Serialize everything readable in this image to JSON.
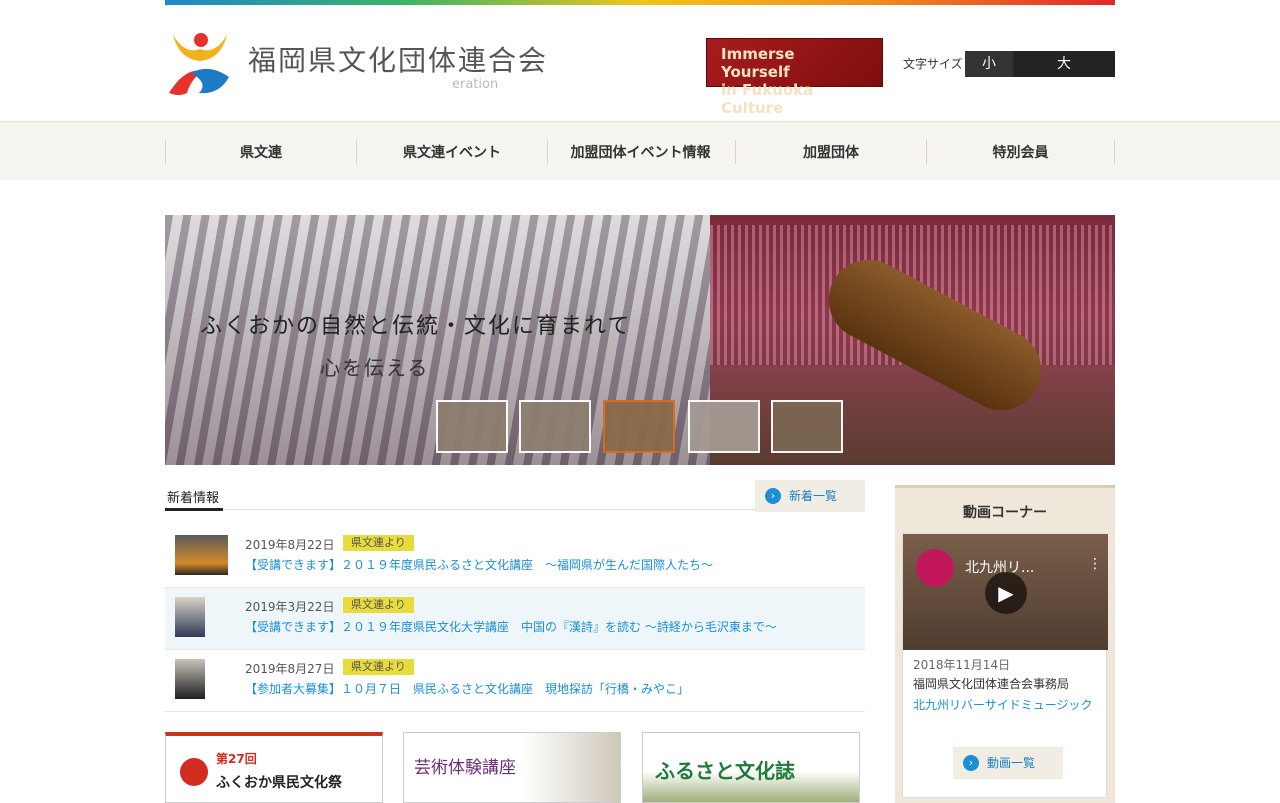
{
  "header": {
    "site_title": "福岡県文化団体連合会",
    "site_sub": "eration",
    "banner_line1": "Immerse Yourself",
    "banner_line2": "in Fukuoka Culture",
    "font_size_label": "文字サイズ",
    "font_small": "小",
    "font_large": "大"
  },
  "nav": {
    "items": [
      "県文連",
      "県文連イベント",
      "加盟団体イベント情報",
      "加盟団体",
      "特別会員"
    ]
  },
  "hero": {
    "text_line1": "ふくおかの自然と伝統・文化に育まれて",
    "text_line2": "心を伝える"
  },
  "news": {
    "heading": "新着情報",
    "more_label": "新着一覧",
    "items": [
      {
        "date": "2019年8月22日",
        "badge": "県文連より",
        "title": "【受講できます】２０１９年度県民ふるさと文化講座　～福岡県が生んだ国際人たち～"
      },
      {
        "date": "2019年3月22日",
        "badge": "県文連より",
        "title": "【受講できます】２０１９年度県民文化大学講座　中国の『漢詩』を読む 〜詩経から毛沢東まで〜"
      },
      {
        "date": "2019年8月27日",
        "badge": "県文連より",
        "title": "【参加者大募集】１０月７日　県民ふるさと文化講座　現地探訪「行橋・みやこ」"
      }
    ]
  },
  "banners": {
    "festival_num": "第27回",
    "festival": "ふくおか県民文化祭",
    "geijutsu": "芸術体験講座",
    "furusato": "ふるさと文化誌"
  },
  "video": {
    "heading": "動画コーナー",
    "frame_title": "北九州リ...",
    "date": "2018年11月14日",
    "org": "福岡県文化団体連合会事務局",
    "link": "北九州リバーサイドミュージック",
    "more_label": "動画一覧"
  }
}
